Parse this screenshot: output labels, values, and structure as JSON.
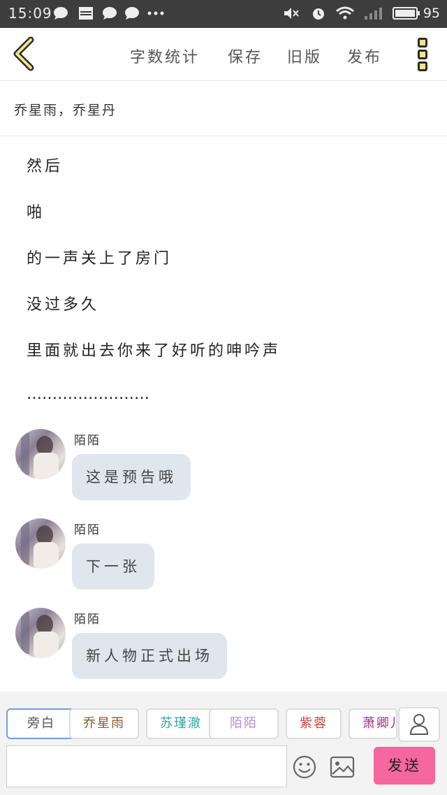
{
  "status_bar": {
    "time": "15:09",
    "battery": "95",
    "icons": [
      "chat-bubble-icon",
      "news-icon",
      "chat-bubble-icon",
      "chat-bubble-icon",
      "more-dots-icon",
      "mute-icon",
      "alarm-icon",
      "wifi-icon",
      "signal-icon",
      "battery-icon"
    ]
  },
  "toolbar": {
    "word_count": "字数统计",
    "save": "保存",
    "old_version": "旧版",
    "publish": "发布"
  },
  "title": "乔星雨，乔星丹",
  "paragraphs": [
    "然后",
    "啪",
    "的一声关上了房门",
    "没过多久",
    "里面就出去你来了好听的呻吟声",
    "……………………"
  ],
  "messages": [
    {
      "name": "陌陌",
      "text": "这是预告哦"
    },
    {
      "name": "陌陌",
      "text": "下一张"
    },
    {
      "name": "陌陌",
      "text": "新人物正式出场"
    }
  ],
  "characters": [
    {
      "name": "旁白",
      "color": "#555555"
    },
    {
      "name": "乔星雨",
      "color": "#8a5a2e"
    },
    {
      "name": "苏瑾澈",
      "color": "#2aa6a0"
    },
    {
      "name": "陌陌",
      "color": "#b98ad6"
    },
    {
      "name": "紫蓉",
      "color": "#d0443e"
    },
    {
      "name": "萧卿儿",
      "color": "#9b2f86"
    }
  ],
  "send_label": "发送",
  "colors": {
    "accent": "#f5679e",
    "bubble": "#dfe6ee",
    "active_chip": "#6ea0e8"
  }
}
